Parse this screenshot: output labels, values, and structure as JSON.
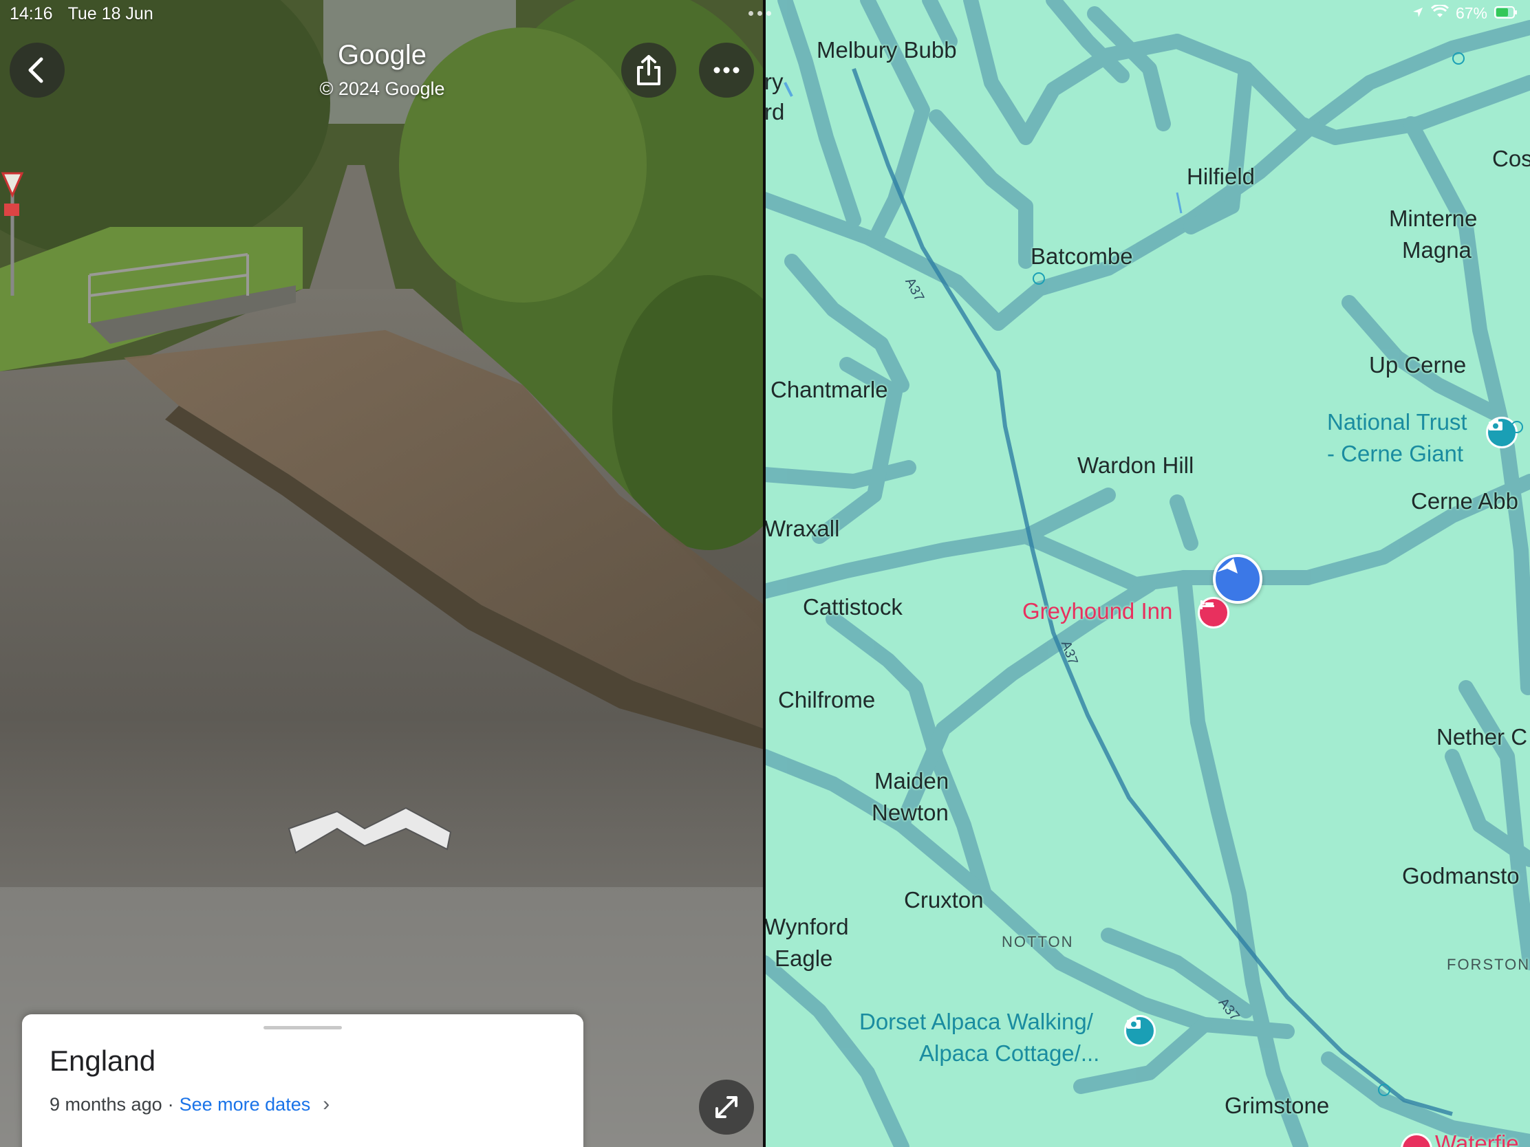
{
  "status_bar": {
    "time": "14:16",
    "date": "Tue 18 Jun",
    "battery": "67%"
  },
  "street_view": {
    "title": "Google",
    "copyright": "© 2024 Google",
    "buttons": {
      "back_icon": "chevron-left-icon",
      "share_icon": "share-icon",
      "more_icon": "more-icon",
      "expand_icon": "expand-icon"
    },
    "card": {
      "title": "England",
      "age": "9 months ago",
      "separator": "·",
      "see_more": "See more dates",
      "chevron": "›"
    }
  },
  "map": {
    "places": {
      "melbury_bubb": "Melbury Bubb",
      "ry": "ry",
      "rd": "rd",
      "hilfield": "Hilfield",
      "cos": "Cos",
      "minterne": "Minterne",
      "magna": "Magna",
      "batcombe": "Batcombe",
      "up_cerne": "Up Cerne",
      "chantmarle": "Chantmarle",
      "wardon_hill": "Wardon Hill",
      "cerne_abb": "Cerne Abb",
      "wraxall": "Wraxall",
      "cattistock": "Cattistock",
      "chilfrome": "Chilfrome",
      "nether_c": "Nether C",
      "maiden": "Maiden",
      "newton": "Newton",
      "godmansto": "Godmansto",
      "cruxton": "Cruxton",
      "wynford": "Wynford",
      "eagle": "Eagle",
      "notton": "NOTTON",
      "forston": "FORSTON",
      "grimstone": "Grimstone"
    },
    "poi": {
      "national_trust_1": "National Trust",
      "national_trust_2": "- Cerne Giant",
      "greyhound_inn": "Greyhound Inn",
      "dorset_alpaca_1": "Dorset Alpaca Walking/",
      "dorset_alpaca_2": "Alpaca Cottage/...",
      "waterfie": "Waterfie"
    },
    "roads": {
      "a37_1": "A37",
      "a37_2": "A37",
      "a37_3": "A37"
    },
    "colors": {
      "land": "#a3ecd0",
      "road": "#6fb5b8",
      "a_road": "#2f7fa4",
      "teal_poi": "#1a9fb5",
      "pink_poi": "#e8305e",
      "location": "#3b78e7"
    }
  }
}
